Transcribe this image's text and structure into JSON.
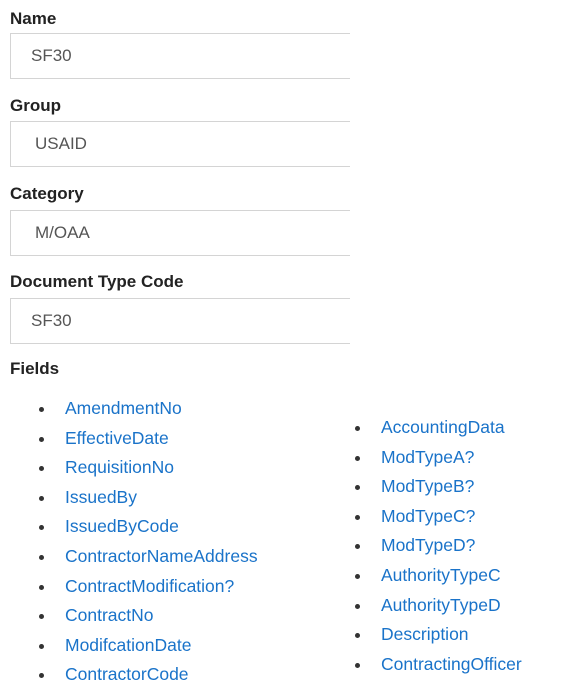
{
  "name": {
    "label": "Name",
    "value": "SF30"
  },
  "group": {
    "label": "Group",
    "value": "USAID"
  },
  "category": {
    "label": "Category",
    "value": "M/OAA"
  },
  "document_type_code": {
    "label": "Document Type Code",
    "value": "SF30"
  },
  "fields": {
    "label": "Fields",
    "left": [
      "AmendmentNo",
      "EffectiveDate",
      "RequisitionNo",
      "IssuedBy",
      "IssuedByCode",
      "ContractorNameAddress",
      "ContractModification?",
      "ContractNo",
      "ModifcationDate",
      "ContractorCode"
    ],
    "right": [
      "AccountingData",
      "ModTypeA?",
      "ModTypeB?",
      "ModTypeC?",
      "ModTypeD?",
      "AuthorityTypeC",
      "AuthorityTypeD",
      "Description",
      "ContractingOfficer"
    ]
  },
  "colors": {
    "link": "#1a73c9",
    "label": "#222222",
    "input_text": "#555555",
    "input_border": "#d4d4d4"
  }
}
